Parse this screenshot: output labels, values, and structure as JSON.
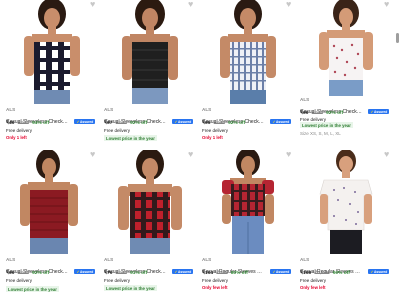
{
  "colors": {
    "accent": "#2874f0",
    "discount": "#388e3c",
    "alert": "#e4002b"
  },
  "products": [
    {
      "brand": "ALS",
      "title": "Casual Sleeveless Checkere...",
      "assured": "Assured",
      "price": "₹49",
      "mrp": "₹999",
      "off": "94% off",
      "delivery": "Free delivery",
      "tag": "Only 1 left",
      "tag_type": "red",
      "sizes": ""
    },
    {
      "brand": "ALS",
      "title": "Casual Sleeveless Checkere...",
      "assured": "Assured",
      "price": "₹67",
      "mrp": "₹899",
      "off": "92% off",
      "delivery": "Free delivery",
      "tag": "Lowest price in the year",
      "tag_type": "green",
      "sizes": ""
    },
    {
      "brand": "ALS",
      "title": "Casual Sleeveless Checkere...",
      "assured": "Assured",
      "price": "₹65",
      "mrp": "₹899",
      "off": "92% off",
      "delivery": "Free delivery",
      "tag": "Only 1 left",
      "tag_type": "red",
      "sizes": ""
    },
    {
      "brand": "ALS",
      "title": "Casual Sleeveless Checkere...",
      "assured": "Assured",
      "price": "₹69",
      "mrp": "₹899",
      "off": "92% off",
      "delivery": "Free delivery",
      "tag": "Lowest price in the year",
      "tag_type": "green",
      "sizes": "Size XS, S, M, L, XL"
    },
    {
      "brand": "ALS",
      "title": "Casual Sleeveless Checkere...",
      "assured": "Assured",
      "price": "₹69",
      "mrp": "₹899",
      "off": "92% off",
      "delivery": "Free delivery",
      "tag": "Lowest price in the year",
      "tag_type": "green",
      "sizes": ""
    },
    {
      "brand": "ALS",
      "title": "Casual Sleeveless Checkere...",
      "assured": "Assured",
      "price": "₹79",
      "mrp": "₹999",
      "off": "91% off",
      "delivery": "Free delivery",
      "tag": "Lowest price in the year",
      "tag_type": "green",
      "sizes": ""
    },
    {
      "brand": "ALS",
      "title": "Casual Regular Sleeves Shop...",
      "assured": "Assured",
      "price": "₹194",
      "mrp": "₹999",
      "off": "80% off",
      "delivery": "Free delivery",
      "tag": "Only few left",
      "tag_type": "red",
      "sizes": ""
    },
    {
      "brand": "ALS",
      "title": "Casual Regular Sleeves Print...",
      "assured": "Assured",
      "price": "₹198",
      "mrp": "₹1,999",
      "off": "90% off",
      "delivery": "Free delivery",
      "tag": "Only few left",
      "tag_type": "red",
      "sizes": ""
    }
  ]
}
